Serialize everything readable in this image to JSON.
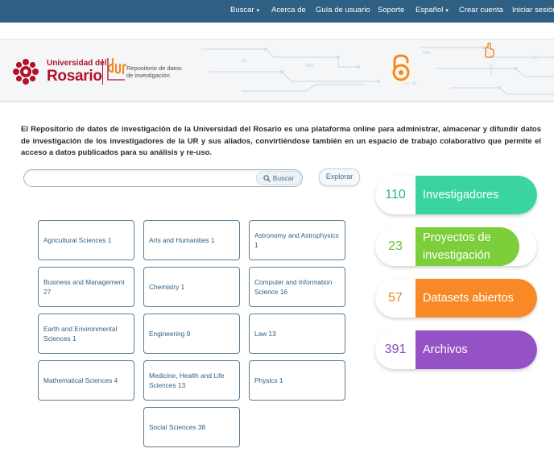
{
  "nav": {
    "items": [
      {
        "label": "Buscar",
        "caret": "▾"
      },
      {
        "label": "Acerca de",
        "caret": ""
      },
      {
        "label": "Guía de usuario",
        "caret": ""
      },
      {
        "label": "Soporte",
        "caret": ""
      },
      {
        "label": "Español",
        "caret": "▾"
      },
      {
        "label": "Crear cuenta",
        "caret": ""
      },
      {
        "label": "Iniciar sesión",
        "caret": ""
      }
    ],
    "bg_color": "#2f5f82"
  },
  "banner": {
    "university_line1": "Universidad del",
    "university_line2": "Rosario",
    "repo_line1": "Repositorio de datos",
    "repo_line2": "de investigación",
    "brand_red": "#b0142a",
    "brand_orange": "#f08a24"
  },
  "intro": "El Repositorio de datos de investigación de la Universidad del Rosario es una plataforma online para administrar, almacenar y difundir datos de investigación de los investigadores de la UR y sus aliados, convirtiéndose también en un espacio de trabajo colaborativo que permite el acceso a datos publicados para su análisis y re-uso.",
  "search": {
    "placeholder": "",
    "value": "",
    "button_label": "Buscar",
    "explore_label": "Explorar"
  },
  "categories": [
    "Agricultural Sciences 1",
    "Arts and Humanities 1",
    "Astronomy and Astrophysics 1",
    "Business and Management 27",
    "Chemistry 1",
    "Computer and Information Science 16",
    "Earth and Environmental Sciences 1",
    "Engineering 9",
    "Law 13",
    "Mathematical Sciences 4",
    "Medicine, Health and Life Sciences 13",
    "Physics 1",
    "Social Sciences 38"
  ],
  "stats": [
    {
      "count": "110",
      "label": "Investigadores",
      "color": "#3ad4a2",
      "num_color": "#2fb585"
    },
    {
      "count": "23",
      "label": "Proyectos de investigación",
      "color": "#7ccf3a",
      "num_color": "#6fbf35"
    },
    {
      "count": "57",
      "label": "Datasets abiertos",
      "color": "#f78a26",
      "num_color": "#f08020"
    },
    {
      "count": "391",
      "label": "Archivos",
      "color": "#9552c6",
      "num_color": "#8a4abb"
    }
  ]
}
